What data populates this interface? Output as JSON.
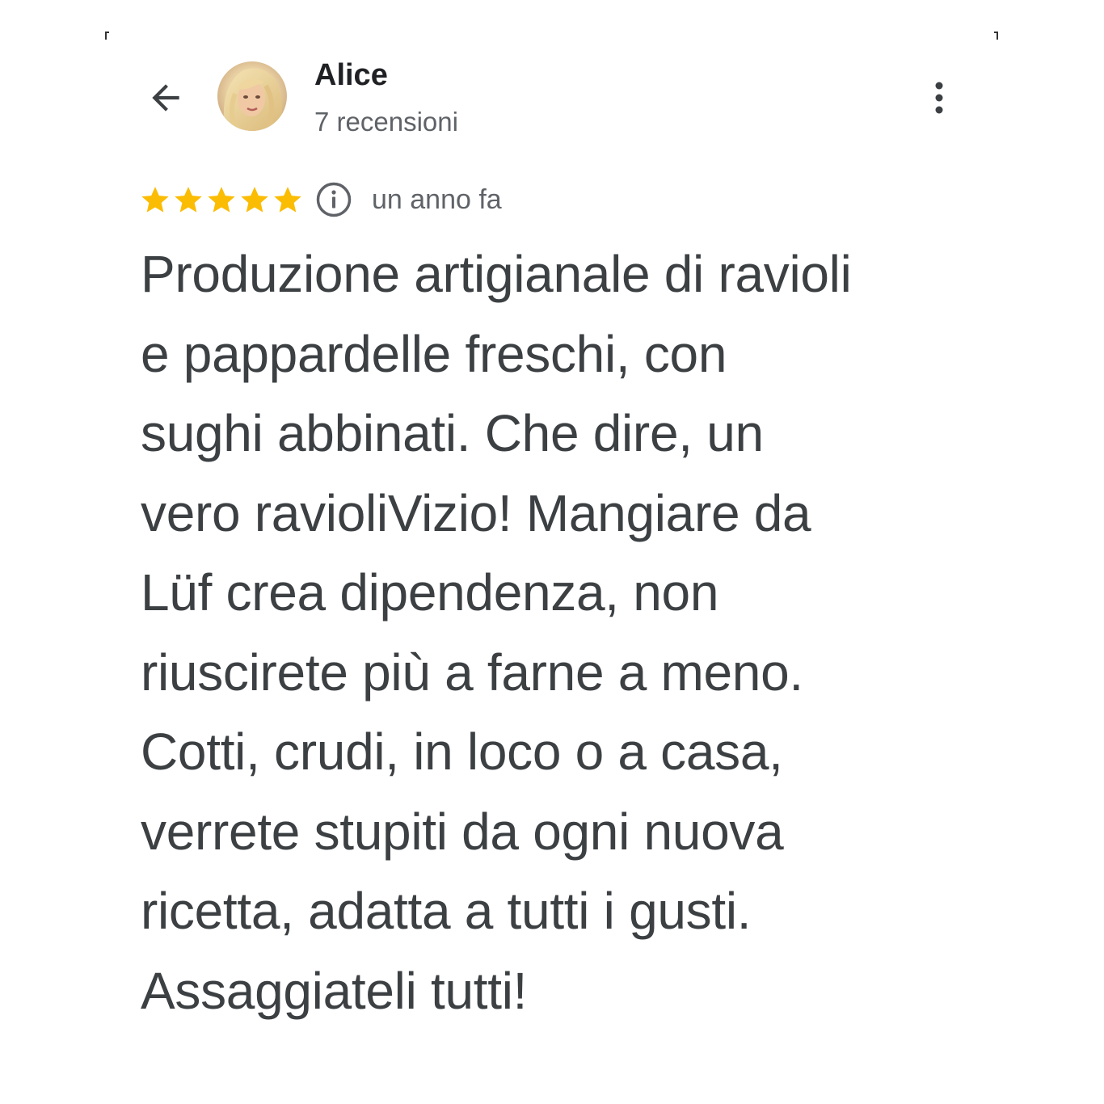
{
  "header": {
    "reviewer_name": "Alice",
    "review_count": "7 recensioni",
    "back_icon": "arrow-left-icon",
    "menu_icon": "more-vertical-icon",
    "avatar_icon": "profile-photo"
  },
  "rating": {
    "stars": 5,
    "max_stars": 5,
    "star_color": "#fbbc04",
    "info_icon": "info-icon",
    "date": "un anno fa"
  },
  "review": {
    "lines": [
      "Produzione artigianale di ravioli",
      "e pappardelle freschi, con",
      "sughi abbinati. Che dire, un",
      "vero ravioliVizio! Mangiare da",
      "Lüf crea dipendenza, non",
      "riuscirete più a farne a meno.",
      "Cotti, crudi, in loco o a casa,",
      "verrete stupiti da ogni nuova",
      "ricetta, adatta a tutti i gusti.",
      "Assaggiateli tutti!"
    ]
  },
  "colors": {
    "text_primary": "#202124",
    "text_secondary": "#5f6368",
    "review_text": "#3c4043",
    "background": "#ffffff"
  }
}
